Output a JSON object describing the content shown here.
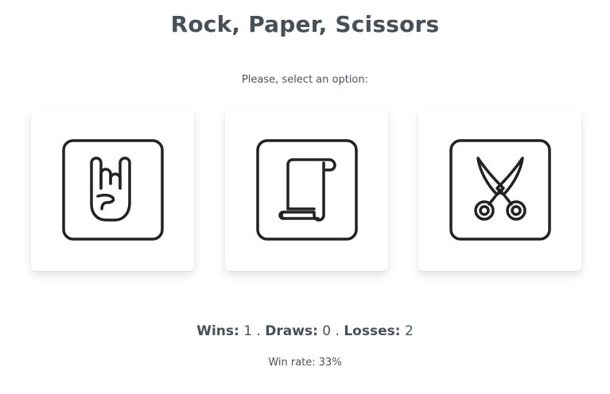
{
  "game": {
    "title": "Rock, Paper, Scissors",
    "prompt": "Please, select an option:"
  },
  "options": [
    {
      "id": "rock",
      "icon": "rock-hand-icon"
    },
    {
      "id": "paper",
      "icon": "paper-scroll-icon"
    },
    {
      "id": "scissors",
      "icon": "scissors-icon"
    }
  ],
  "score": {
    "wins_label": "Wins:",
    "wins": "1",
    "draws_label": "Draws:",
    "draws": "0",
    "losses_label": "Losses:",
    "losses": "2",
    "separator": "."
  },
  "winrate": "Win rate: 33%",
  "colors": {
    "icon_stroke": "#222222",
    "title": "#475059",
    "text": "#4c545c"
  }
}
